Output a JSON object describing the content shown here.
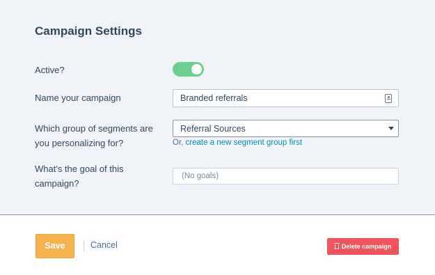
{
  "settings": {
    "title": "Campaign Settings",
    "active_label": "Active?",
    "active_value": true,
    "name_label": "Name your campaign",
    "name_value": "Branded referrals",
    "segments_label_line1": "Which group of segments are",
    "segments_label_line2": "you personalizing for?",
    "segments_selected": "Referral Sources",
    "helper_prefix": "Or,",
    "helper_link": "create a new segment group first",
    "goal_label_line1": "What's the goal of this",
    "goal_label_line2": "campaign?",
    "goal_placeholder": "(No goals)"
  },
  "footer": {
    "save_label": "Save",
    "cancel_label": "Cancel",
    "delete_label": "Delete campaign"
  },
  "colors": {
    "panel_bg": "#f0f3f8",
    "toggle_on": "#6ccf8e",
    "save": "#f5b24d",
    "delete": "#f2545b",
    "link": "#0091ae"
  },
  "icons": [
    "contact-card-icon",
    "dropdown-caret-icon",
    "trash-icon"
  ]
}
